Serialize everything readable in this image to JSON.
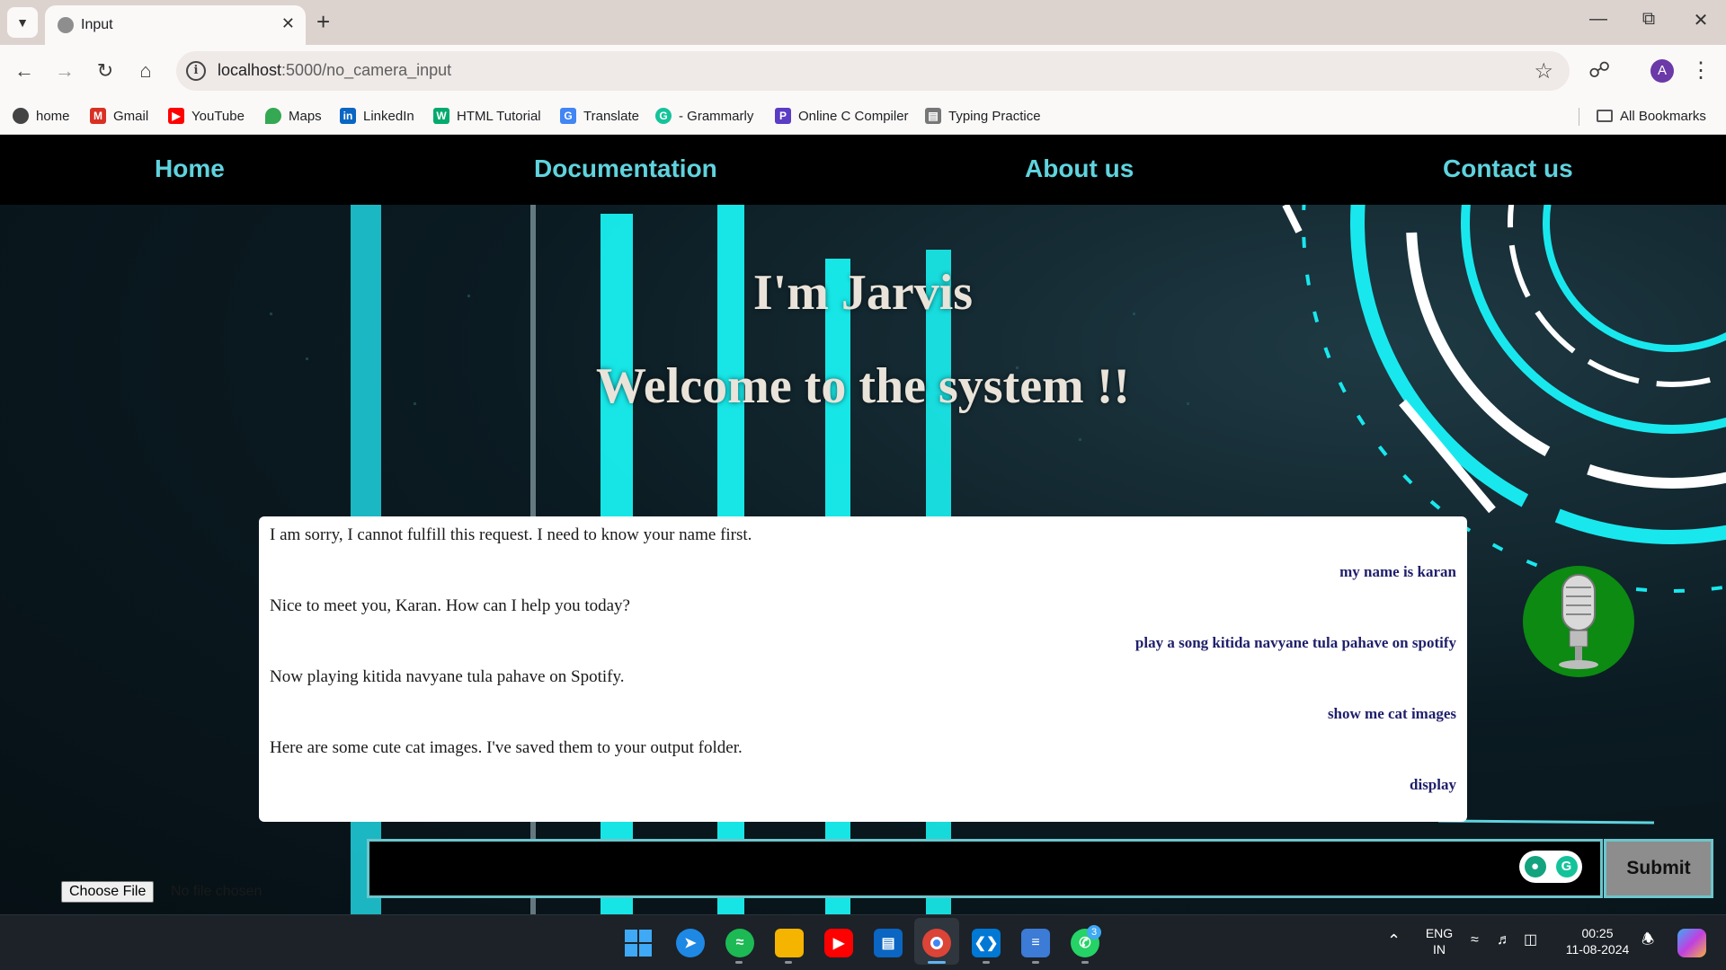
{
  "browser": {
    "tab_title": "Input",
    "url_host": "localhost",
    "url_path": ":5000/no_camera_input",
    "avatar_letter": "A",
    "bookmarks": [
      {
        "label": "home",
        "icon": "globe-icon",
        "color": "#444444"
      },
      {
        "label": "Gmail",
        "icon": "gmail-icon",
        "color": "#d93025"
      },
      {
        "label": "YouTube",
        "icon": "youtube-icon",
        "color": "#ff0000"
      },
      {
        "label": "Maps",
        "icon": "maps-icon",
        "color": "#34a853"
      },
      {
        "label": "LinkedIn",
        "icon": "linkedin-icon",
        "color": "#0a66c2"
      },
      {
        "label": "HTML Tutorial",
        "icon": "w3schools-icon",
        "color": "#04aa6d"
      },
      {
        "label": "Translate",
        "icon": "translate-icon",
        "color": "#4285f4"
      },
      {
        "label": "- Grammarly",
        "icon": "grammarly-icon",
        "color": "#15c39a"
      },
      {
        "label": "Online C Compiler",
        "icon": "compiler-icon",
        "color": "#5b3cc4"
      },
      {
        "label": "Typing Practice",
        "icon": "keyboard-icon",
        "color": "#777777"
      }
    ],
    "all_bookmarks": "All Bookmarks"
  },
  "nav": {
    "home": "Home",
    "documentation": "Documentation",
    "about": "About us",
    "contact": "Contact us"
  },
  "hero": {
    "title": "I'm Jarvis",
    "subtitle": "Welcome to the system !!"
  },
  "chat": [
    {
      "role": "bot",
      "text": "I am sorry, I cannot fulfill this request. I need to know your name first."
    },
    {
      "role": "user",
      "text": "my name is karan"
    },
    {
      "role": "bot",
      "text": "Nice to meet you, Karan. How can I help you today?"
    },
    {
      "role": "user",
      "text": "play a song kitida navyane tula pahave on spotify"
    },
    {
      "role": "bot",
      "text": "Now playing kitida navyane tula pahave on Spotify."
    },
    {
      "role": "user",
      "text": "show me cat images"
    },
    {
      "role": "bot",
      "text": "Here are some cute cat images. I've saved them to your output folder."
    },
    {
      "role": "user",
      "text": "display"
    }
  ],
  "form": {
    "input_value": "",
    "submit_label": "Submit",
    "choose_file_label": "Choose File",
    "file_status": "No file chosen"
  },
  "taskbar": {
    "language_line1": "ENG",
    "language_line2": "IN",
    "time": "00:25",
    "date": "11-08-2024",
    "whatsapp_badge": "3"
  },
  "colors": {
    "nav_link": "#5fd3de",
    "accent_cyan": "#18f0f0",
    "mic_green": "#0c8a12",
    "user_msg": "#1f1f6b"
  }
}
